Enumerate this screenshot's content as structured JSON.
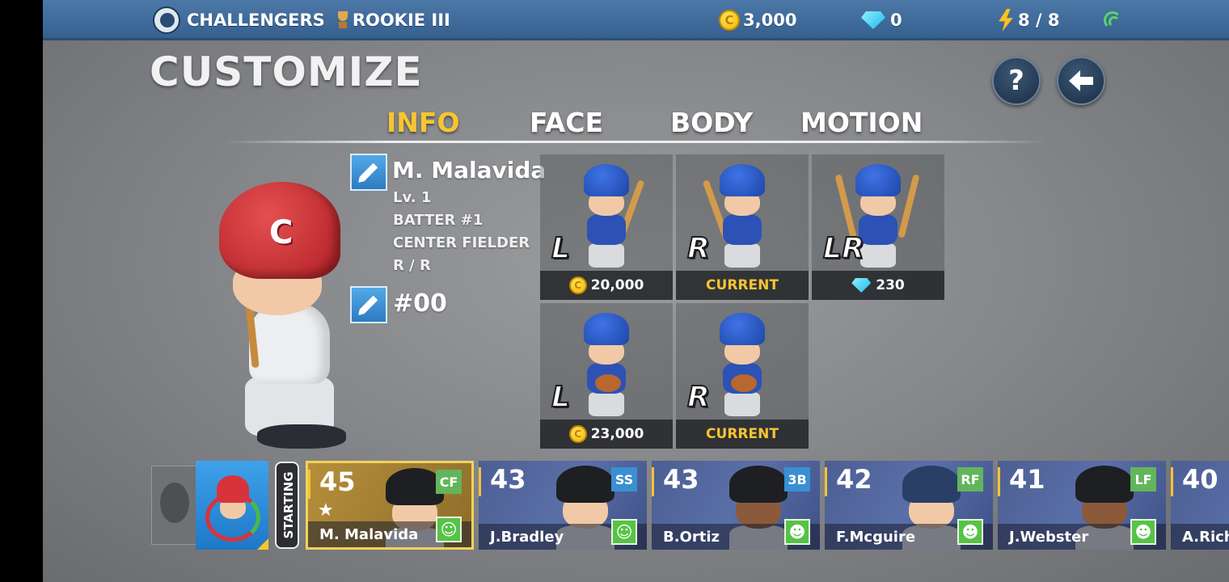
{
  "topbar": {
    "team_name": "CHALLENGERS",
    "rank": "ROOKIE III",
    "coins": "3,000",
    "gems": "0",
    "energy": "8 / 8",
    "icons": [
      "team-logo",
      "trophy-icon",
      "coin-icon",
      "gem-icon",
      "lightning-icon",
      "signal-icon"
    ]
  },
  "header": {
    "title": "CUSTOMIZE",
    "help_label": "?",
    "back_icon": "arrow-left-icon"
  },
  "tabs": [
    {
      "label": "INFO",
      "active": true
    },
    {
      "label": "FACE",
      "active": false
    },
    {
      "label": "BODY",
      "active": false
    },
    {
      "label": "MOTION",
      "active": false
    }
  ],
  "player": {
    "name": "M. Malavida",
    "level": "Lv. 1",
    "batting_order": "BATTER #1",
    "position": "CENTER FIELDER",
    "throws_bats": "R / R",
    "number": "#00",
    "cap_letter": "C"
  },
  "motion_cards": [
    {
      "hand": "L",
      "price": "20,000",
      "currency": "coin",
      "current": false
    },
    {
      "hand": "R",
      "price": "CURRENT",
      "currency": "",
      "current": true
    },
    {
      "hand": "LR",
      "price": "230",
      "currency": "gem",
      "current": false
    },
    {
      "hand": "L",
      "price": "23,000",
      "currency": "coin",
      "current": false
    },
    {
      "hand": "R",
      "price": "CURRENT",
      "currency": "",
      "current": true
    }
  ],
  "roster": {
    "starting_label": "STARTING",
    "players": [
      {
        "ovr": "45",
        "pos": "CF",
        "name": "M. Malavida",
        "selected": true
      },
      {
        "ovr": "43",
        "pos": "SS",
        "name": "J.Bradley",
        "selected": false
      },
      {
        "ovr": "43",
        "pos": "3B",
        "name": "B.Ortiz",
        "selected": false
      },
      {
        "ovr": "42",
        "pos": "RF",
        "name": "F.Mcguire",
        "selected": false
      },
      {
        "ovr": "41",
        "pos": "LF",
        "name": "J.Webster",
        "selected": false
      },
      {
        "ovr": "40",
        "pos": "",
        "name": "A.Rich",
        "selected": false
      }
    ]
  },
  "colors": {
    "accent": "#f7c532",
    "topbar": "#3d6a9a",
    "position_infield": "#3a8fd2",
    "position_outfield": "#63b55b"
  }
}
